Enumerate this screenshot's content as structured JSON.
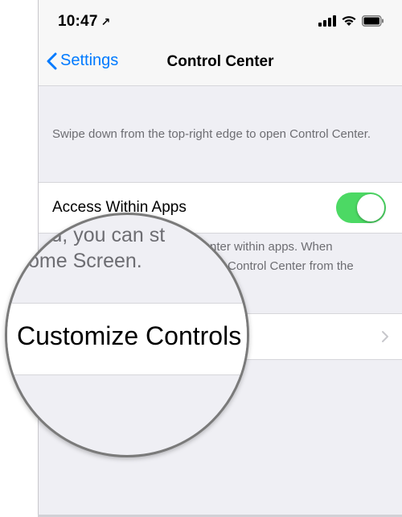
{
  "status_bar": {
    "time": "10:47",
    "location_glyph": "↗"
  },
  "nav": {
    "back_label": "Settings",
    "title": "Control Center"
  },
  "description": "Swipe down from the top-right edge to open Control Center.",
  "access_row": {
    "label": "Access Within Apps",
    "toggle_on": true,
    "toggle_color": "#4cd964"
  },
  "footnote": {
    "line1_partial": "nter within apps. When",
    "line2_partial": "Control Center from the"
  },
  "magnifier": {
    "line1": "ıled, you can st",
    "line2": "ome Screen.",
    "row_label": "Customize Controls"
  },
  "colors": {
    "accent": "#007aff",
    "background": "#efeff4"
  }
}
